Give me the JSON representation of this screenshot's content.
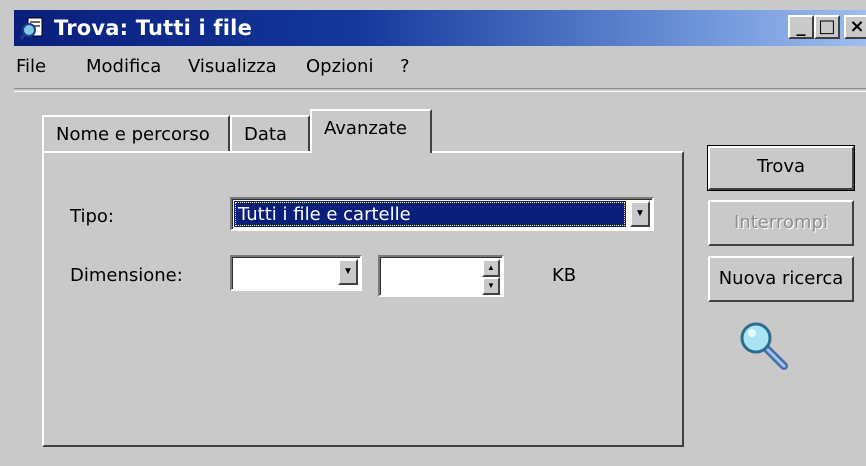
{
  "window": {
    "title": "Trova: Tutti i file",
    "controls": {
      "minimize": "_",
      "maximize": "□",
      "close": "×"
    }
  },
  "menu": [
    "File",
    "Modifica",
    "Visualizza",
    "Opzioni",
    "?"
  ],
  "tabs": [
    {
      "label": "Nome e percorso",
      "active": false
    },
    {
      "label": "Data",
      "active": false
    },
    {
      "label": "Avanzate",
      "active": true
    }
  ],
  "advanced": {
    "tipo_label": "Tipo:",
    "tipo_value": "Tutti i file e cartelle",
    "dimensione_label": "Dimensione:",
    "dimensione_mode": "",
    "dimensione_value": "",
    "unit": "KB"
  },
  "buttons": {
    "trova": "Trova",
    "interrompi": "Interrompi",
    "nuova_ricerca": "Nuova ricerca"
  },
  "icons": {
    "title": "find-files-icon",
    "magnifier": "magnifier-icon"
  },
  "colors": {
    "titlebar_start": "#0a1e7c",
    "titlebar_end": "#9fbdf0",
    "selection": "#0a1e7c",
    "face": "#c9c9c9"
  }
}
